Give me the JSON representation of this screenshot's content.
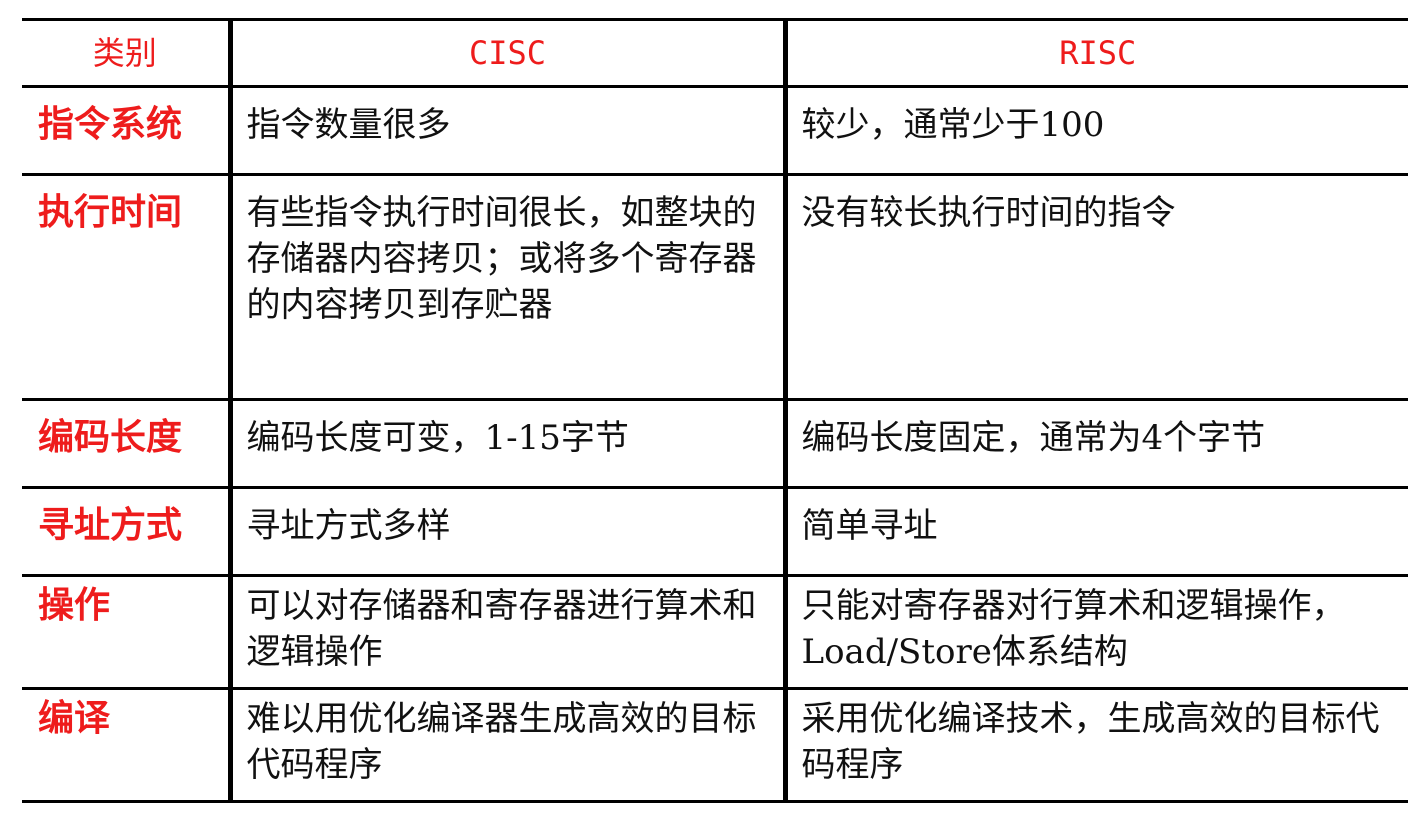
{
  "table": {
    "headers": {
      "category": "类别",
      "cisc": "CISC",
      "risc": "RISC"
    },
    "rows": [
      {
        "category": "指令系统",
        "cisc": "指令数量很多",
        "risc": "较少，通常少于100"
      },
      {
        "category": "执行时间",
        "cisc": "有些指令执行时间很长，如整块的存储器内容拷贝；或将多个寄存器的内容拷贝到存贮器",
        "risc": "没有较长执行时间的指令"
      },
      {
        "category": "编码长度",
        "cisc": "编码长度可变，1-15字节",
        "risc": "编码长度固定，通常为4个字节"
      },
      {
        "category": "寻址方式",
        "cisc": "寻址方式多样",
        "risc": "简单寻址"
      },
      {
        "category": "操作",
        "cisc": "可以对存储器和寄存器进行算术和逻辑操作",
        "risc": "只能对寄存器对行算术和逻辑操作，Load/Store体系结构"
      },
      {
        "category": "编译",
        "cisc": "难以用优化编译器生成高效的目标代码程序",
        "risc": "采用优化编译技术，生成高效的目标代码程序"
      }
    ]
  },
  "colors": {
    "category_text": "#ee1c1c",
    "body_text": "#111111",
    "rule": "#000000"
  }
}
